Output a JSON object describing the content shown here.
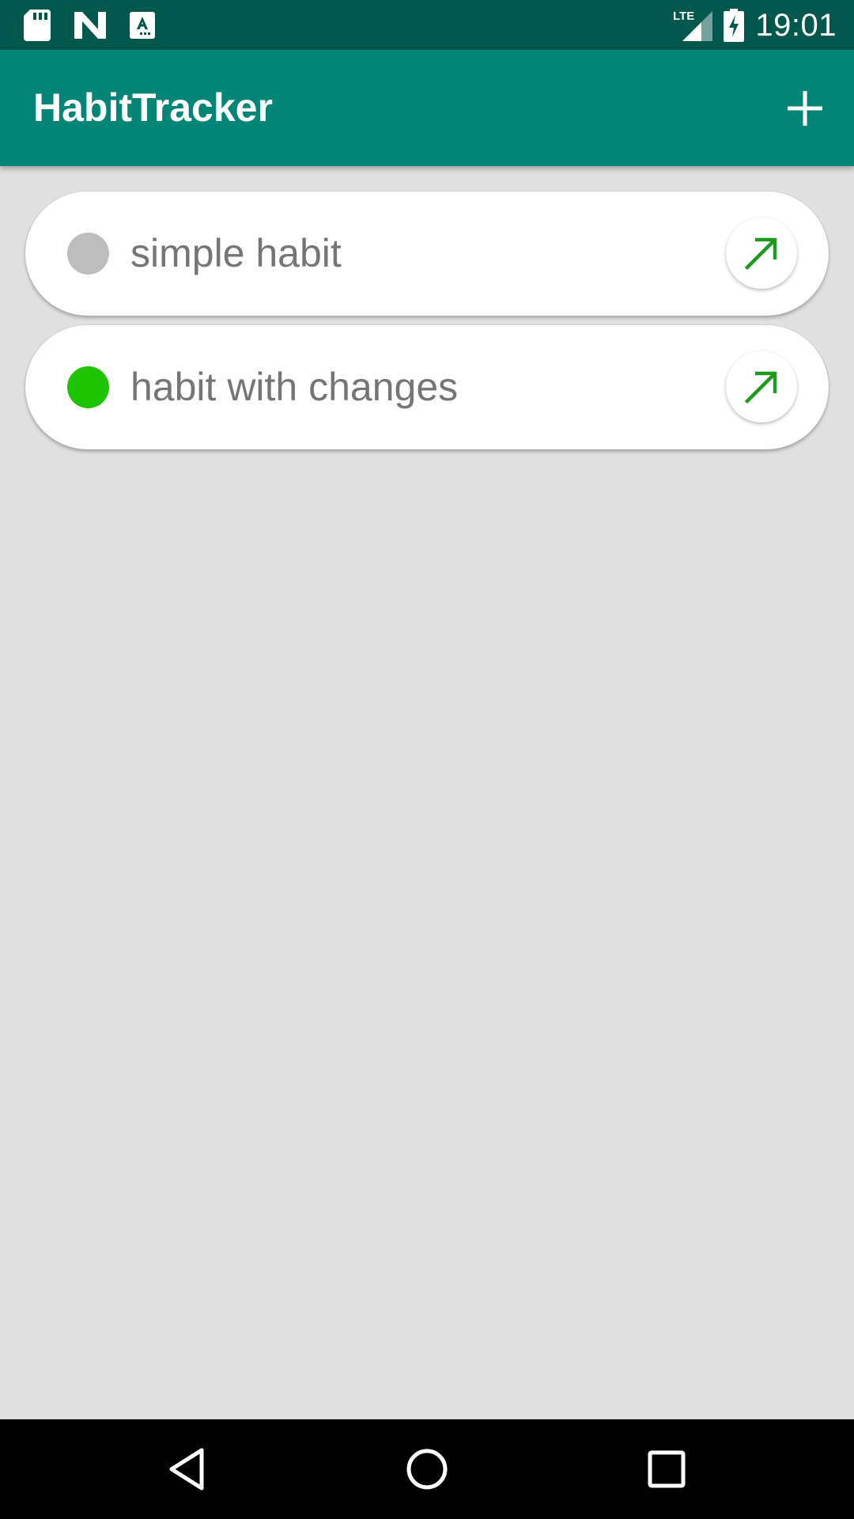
{
  "status_bar": {
    "left_icons": [
      "sd-card-icon",
      "n-logo-icon",
      "keyboard-a-icon"
    ],
    "network_label": "LTE",
    "time": "19:01"
  },
  "app_bar": {
    "title": "HabitTracker",
    "add_icon": "plus-icon"
  },
  "habits": [
    {
      "name": "simple habit",
      "status_color": "#bdbdbd",
      "action_icon": "trend-arrow-icon"
    },
    {
      "name": "habit with changes",
      "status_color": "#1ec400",
      "action_icon": "trend-arrow-icon"
    }
  ],
  "colors": {
    "status_bar": "#00574b",
    "primary": "#008577",
    "background": "#e0e0e0",
    "accent_arrow": "#1e9a1e",
    "habit_text": "#757575"
  },
  "nav_bar": {
    "buttons": [
      "back-icon",
      "home-icon",
      "recents-icon"
    ]
  }
}
